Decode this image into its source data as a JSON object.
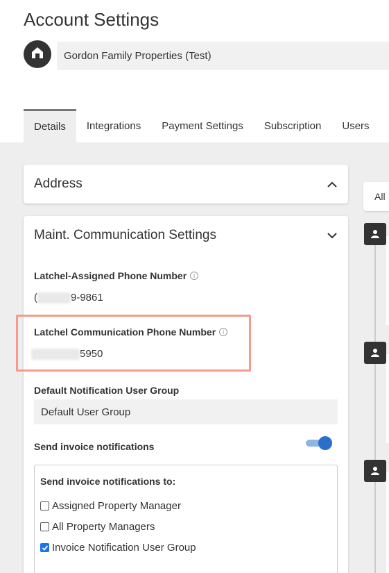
{
  "page": {
    "title": "Account Settings"
  },
  "org": {
    "name": "Gordon Family Properties (Test)",
    "avatar_icon": "home-icon"
  },
  "tabs": [
    {
      "label": "Details",
      "active": true
    },
    {
      "label": "Integrations",
      "active": false
    },
    {
      "label": "Payment Settings",
      "active": false
    },
    {
      "label": "Subscription",
      "active": false
    },
    {
      "label": "Users",
      "active": false
    }
  ],
  "address_card": {
    "title": "Address",
    "expanded": false,
    "icon": "chevron-up-icon"
  },
  "maint_card": {
    "title": "Maint. Communication Settings",
    "icon": "chevron-down-icon",
    "assigned_phone_label": "Latchel-Assigned Phone Number",
    "assigned_phone_prefix": "(",
    "assigned_phone_suffix": "9-9861",
    "comm_phone_label": "Latchel Communication Phone Number",
    "comm_phone_suffix": "5950",
    "default_group_label": "Default Notification User Group",
    "default_group_value": "Default User Group",
    "send_invoice_label": "Send invoice notifications",
    "send_invoice_enabled": true,
    "send_to_label": "Send invoice notifications to:",
    "options": [
      {
        "label": "Assigned Property Manager",
        "checked": false
      },
      {
        "label": "All Property Managers",
        "checked": false
      },
      {
        "label": "Invoice Notification User Group",
        "checked": true
      }
    ]
  },
  "right_panel": {
    "tab_label": "All"
  },
  "colors": {
    "accent": "#2a6fc9",
    "highlight": "#f59a8c"
  }
}
